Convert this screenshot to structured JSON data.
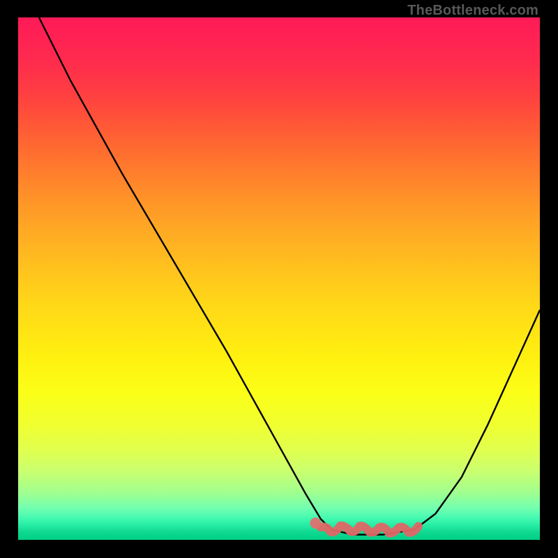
{
  "attribution": "TheBottleneck.com",
  "colors": {
    "curve": "#000000",
    "marker_stroke": "#e06666",
    "marker_fill": "#e06666",
    "dot_fill": "#e07070"
  },
  "chart_data": {
    "type": "line",
    "title": "",
    "xlabel": "",
    "ylabel": "",
    "xlim": [
      0,
      100
    ],
    "ylim": [
      0,
      100
    ],
    "series": [
      {
        "name": "bottleneck_curve",
        "x": [
          4,
          10,
          20,
          30,
          40,
          50,
          55,
          58,
          60,
          64,
          70,
          76,
          80,
          85,
          90,
          100
        ],
        "y": [
          100,
          88,
          70,
          53,
          36,
          18,
          9,
          4,
          2,
          1,
          1,
          2,
          5,
          12,
          22,
          44
        ]
      }
    ],
    "highlight": {
      "range_x": [
        58,
        78
      ],
      "range_y_baseline": 2,
      "dot": {
        "x": 57,
        "y": 3.2
      }
    }
  }
}
